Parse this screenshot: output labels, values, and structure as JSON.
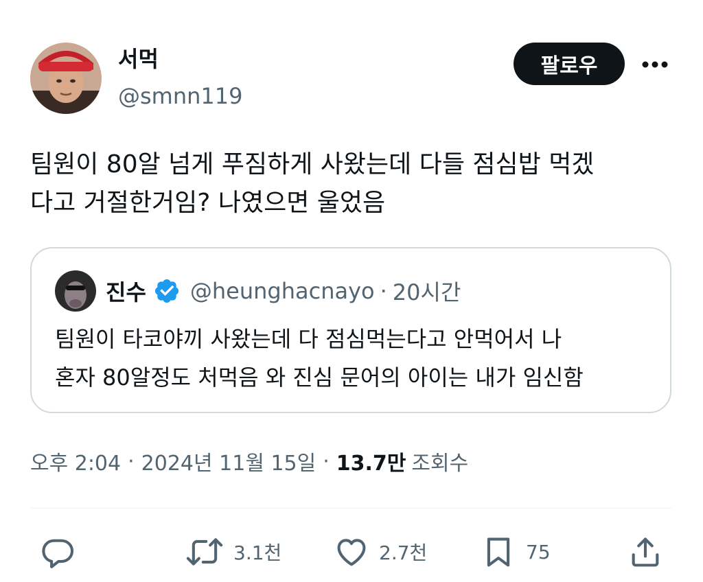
{
  "author": {
    "display_name": "서먹",
    "handle": "@smnn119"
  },
  "follow_button": "팔로우",
  "more_icon": "more-horizontal-icon",
  "tweet": {
    "text": "팀원이 80알 넘게 푸짐하게 사왔는데 다들 점심밥 먹겠\n다고 거절한거임? 나였으면 울었음"
  },
  "quote": {
    "display_name": "진수",
    "handle": "@heunghacnayo",
    "separator": "·",
    "time": "20시간",
    "text": "팀원이 타코야끼 사왔는데 다 점심먹는다고 안먹어서 나\n혼자 80알정도 처먹음 와 진심 문어의 아이는 내가 임신함",
    "verified_color": "#1d9bf0"
  },
  "meta": {
    "time": "오후 2:04",
    "separator": "·",
    "date": "2024년 11월 15일",
    "views_count": "13.7만",
    "views_label": "조회수"
  },
  "actions": {
    "reply": {
      "icon": "reply-icon",
      "count": ""
    },
    "retweet": {
      "icon": "retweet-icon",
      "count": "3.1천"
    },
    "like": {
      "icon": "heart-icon",
      "count": "2.7천"
    },
    "bookmark": {
      "icon": "bookmark-icon",
      "count": "75"
    },
    "share": {
      "icon": "share-icon",
      "count": ""
    }
  },
  "colors": {
    "text_primary": "#0f1419",
    "text_secondary": "#536471",
    "border": "#cfd9de",
    "verified": "#1d9bf0",
    "follow_bg": "#0f1419"
  }
}
